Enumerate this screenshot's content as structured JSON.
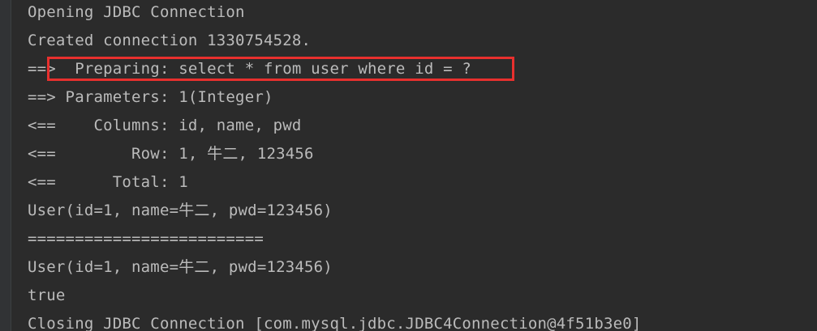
{
  "console": {
    "lines": [
      "Opening JDBC Connection",
      "Created connection 1330754528.",
      "==>  Preparing: select * from user where id = ?",
      "==> Parameters: 1(Integer)",
      "<==    Columns: id, name, pwd",
      "<==        Row: 1, 牛二, 123456",
      "<==      Total: 1",
      "User(id=1, name=牛二, pwd=123456)",
      "=========================",
      "User(id=1, name=牛二, pwd=123456)",
      "true",
      "Closing JDBC Connection [com.mysql.jdbc.JDBC4Connection@4f51b3e0]"
    ]
  },
  "colors": {
    "background": "#2b2b2b",
    "text": "#bbbbbb",
    "highlight_border": "#e8302e"
  }
}
